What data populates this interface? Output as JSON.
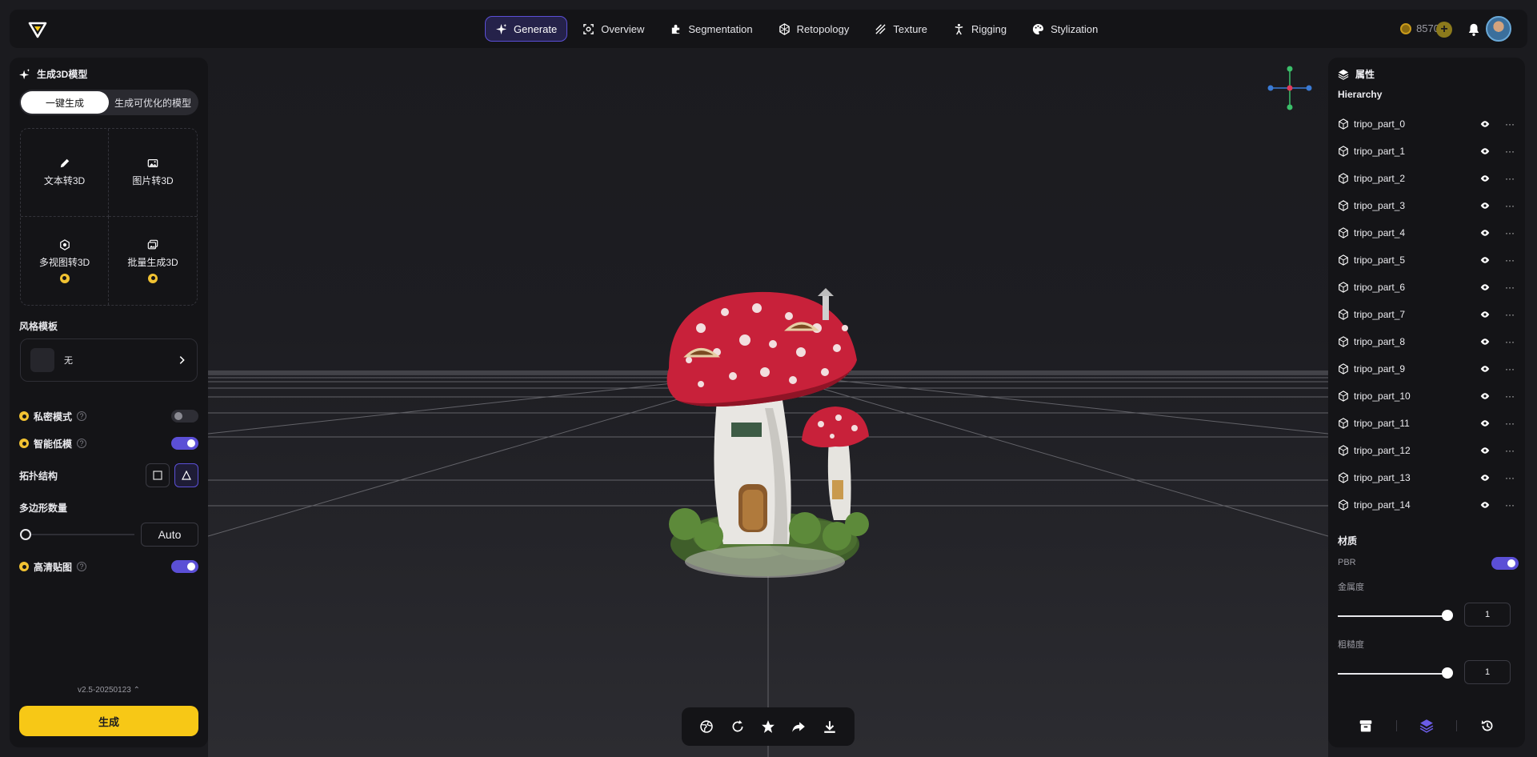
{
  "nav": {
    "items": [
      {
        "label": "Generate",
        "icon": "sparkle-icon",
        "active": true
      },
      {
        "label": "Overview",
        "icon": "scan-icon"
      },
      {
        "label": "Segmentation",
        "icon": "puzzle-icon"
      },
      {
        "label": "Retopology",
        "icon": "retopology-icon"
      },
      {
        "label": "Texture",
        "icon": "texture-icon"
      },
      {
        "label": "Rigging",
        "icon": "rigging-icon"
      },
      {
        "label": "Stylization",
        "icon": "palette-icon"
      }
    ],
    "credits": "8570"
  },
  "left": {
    "title": "生成3D模型",
    "seg_one_click": "一键生成",
    "seg_optimizable": "生成可优化的模型",
    "modes": [
      {
        "label": "文本转3D",
        "icon": "pencil-icon",
        "premium": false
      },
      {
        "label": "图片转3D",
        "icon": "image-icon",
        "premium": false
      },
      {
        "label": "多视图转3D",
        "icon": "multiview-icon",
        "premium": true
      },
      {
        "label": "批量生成3D",
        "icon": "batch-icon",
        "premium": true
      }
    ],
    "style_label": "风格模板",
    "style_value": "无",
    "private_label": "私密模式",
    "smart_low_label": "智能低模",
    "topology_label": "拓扑结构",
    "polycount_label": "多边形数量",
    "polycount_value": "Auto",
    "hd_texture_label": "高清贴图",
    "version": "v2.5-20250123",
    "generate_btn": "生成"
  },
  "right": {
    "title": "属性",
    "hierarchy_label": "Hierarchy",
    "parts": [
      "tripo_part_0",
      "tripo_part_1",
      "tripo_part_2",
      "tripo_part_3",
      "tripo_part_4",
      "tripo_part_5",
      "tripo_part_6",
      "tripo_part_7",
      "tripo_part_8",
      "tripo_part_9",
      "tripo_part_10",
      "tripo_part_11",
      "tripo_part_12",
      "tripo_part_13",
      "tripo_part_14"
    ],
    "material_label": "材质",
    "pbr_label": "PBR",
    "metalness_label": "金属度",
    "metalness_value": "1",
    "roughness_label": "粗糙度",
    "roughness_value": "1"
  },
  "colors": {
    "accent": "#5b4fd6",
    "generate": "#f7c816"
  }
}
